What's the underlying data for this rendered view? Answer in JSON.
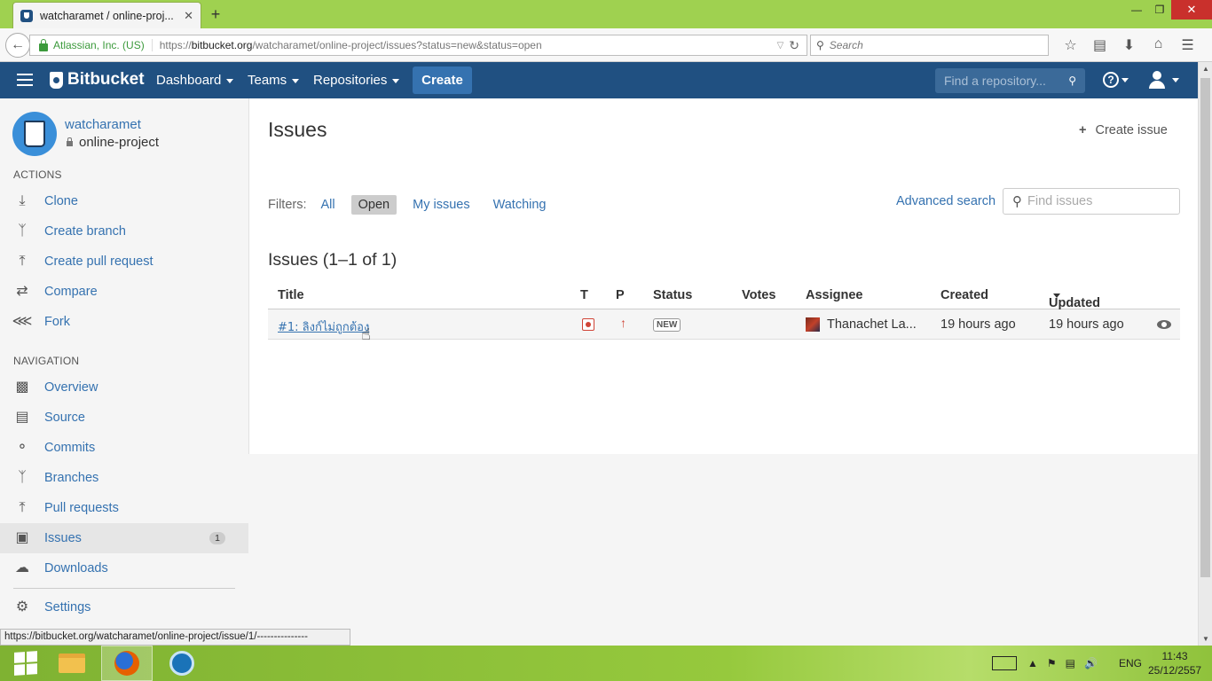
{
  "browser": {
    "tab_title": "watcharamet / online-proj...",
    "tab_close": "✕",
    "new_tab": "+",
    "window_controls": {
      "minimize": "—",
      "restore": "❐",
      "close": "✕"
    },
    "site_identity": "Atlassian, Inc. (US)",
    "url_prefix": "https://",
    "url_host": "bitbucket.org",
    "url_path": "/watcharamet/online-project/issues?status=new&status=open",
    "search_placeholder": "Search",
    "icons": [
      "bookmark-star-icon",
      "reading-list-icon",
      "download-icon",
      "home-icon",
      "menu-icon"
    ]
  },
  "header": {
    "brand": "Bitbucket",
    "nav": [
      "Dashboard",
      "Teams",
      "Repositories"
    ],
    "create_label": "Create",
    "repo_search_placeholder": "Find a repository...",
    "help_symbol": "?",
    "color": "#205081"
  },
  "sidebar": {
    "owner": "watcharamet",
    "repo": "online-project",
    "actions_heading": "ACTIONS",
    "actions": [
      {
        "label": "Clone",
        "icon": "clone-icon"
      },
      {
        "label": "Create branch",
        "icon": "create-branch-icon"
      },
      {
        "label": "Create pull request",
        "icon": "create-pull-request-icon"
      },
      {
        "label": "Compare",
        "icon": "compare-icon"
      },
      {
        "label": "Fork",
        "icon": "fork-icon"
      }
    ],
    "navigation_heading": "NAVIGATION",
    "navigation": [
      {
        "label": "Overview",
        "icon": "overview-icon"
      },
      {
        "label": "Source",
        "icon": "source-icon"
      },
      {
        "label": "Commits",
        "icon": "commits-icon"
      },
      {
        "label": "Branches",
        "icon": "branches-icon"
      },
      {
        "label": "Pull requests",
        "icon": "pull-requests-icon"
      },
      {
        "label": "Issues",
        "icon": "issues-icon",
        "badge": "1",
        "active": true
      },
      {
        "label": "Downloads",
        "icon": "downloads-icon"
      }
    ],
    "settings": {
      "label": "Settings",
      "icon": "settings-icon"
    }
  },
  "main": {
    "title": "Issues",
    "create_issue": "Create issue",
    "filters_label": "Filters:",
    "filters": [
      "All",
      "Open",
      "My issues",
      "Watching"
    ],
    "active_filter": "Open",
    "advanced_search": "Advanced search",
    "find_issues_placeholder": "Find issues",
    "count_title": "Issues (1–1 of 1)",
    "columns": [
      "Title",
      "T",
      "P",
      "Status",
      "Votes",
      "Assignee",
      "Created",
      "Updated"
    ],
    "rows": [
      {
        "title": "#1: ลิงก์ไม่ถูกต้อง",
        "type": "bug-icon",
        "priority": "↑",
        "status": "NEW",
        "votes": "",
        "assignee": "Thanachet La...",
        "created": "19 hours ago",
        "updated": "19 hours ago"
      }
    ]
  },
  "status_bar": "https://bitbucket.org/watcharamet/online-project/issue/1/---------------",
  "taskbar": {
    "language": "ENG",
    "time": "11:43",
    "date": "25/12/2557"
  }
}
